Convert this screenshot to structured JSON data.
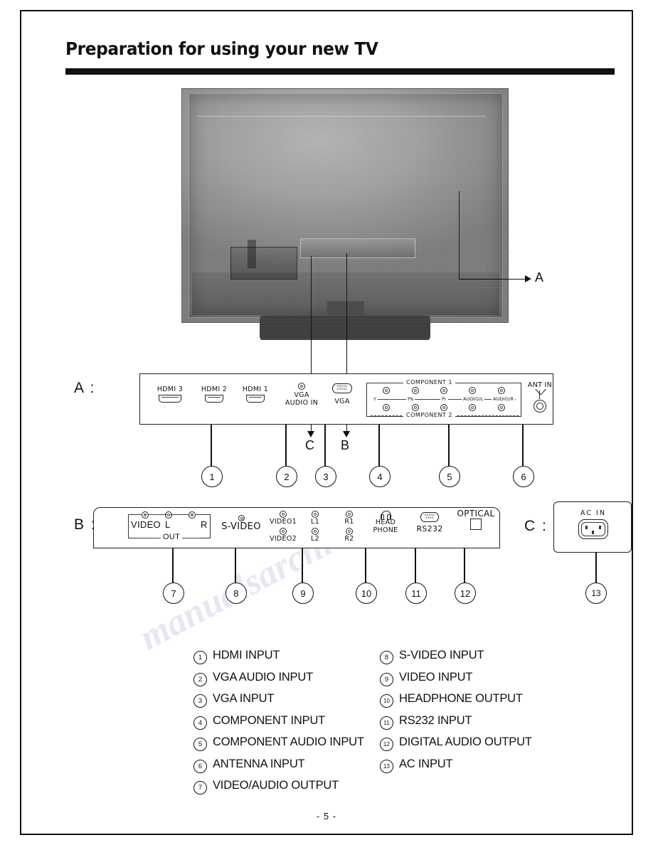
{
  "page": {
    "title": "Preparation for using your new TV",
    "footer": "- 5 -"
  },
  "photo": {
    "callout_a": "A",
    "callout_b": "B",
    "callout_c": "C"
  },
  "sections": {
    "a_label": "A :",
    "b_label": "B :",
    "c_label": "C :"
  },
  "panel_a": {
    "ports": [
      {
        "label": "HDMI 3",
        "icon": "hdmi-port-icon"
      },
      {
        "label": "HDMI 2",
        "icon": "hdmi-port-icon"
      },
      {
        "label": "HDMI 1",
        "icon": "hdmi-port-icon"
      },
      {
        "label_line1": "VGA",
        "label_line2": "AUDIO IN",
        "icon": "audio-jack-icon"
      },
      {
        "label": "VGA",
        "icon": "dsub-connector-icon"
      }
    ],
    "component": {
      "title_top": "COMPONENT 1",
      "title_bottom": "COMPONENT 2",
      "signals": [
        "Y",
        "Pb",
        "Pr",
        "AUDIO/L",
        "AUDIO/R"
      ]
    },
    "antenna": {
      "label": "ANT IN",
      "icon": "antenna-icon"
    }
  },
  "panel_b": {
    "video_out": {
      "video": "VIDEO",
      "left": "L",
      "right": "R",
      "out": "OUT"
    },
    "svideo": "S-VIDEO",
    "video_inputs": [
      "VIDEO1",
      "VIDEO2"
    ],
    "audio_left": [
      "L1",
      "L2"
    ],
    "audio_right": [
      "R1",
      "R2"
    ],
    "headphone_line1": "HEAD",
    "headphone_line2": "PHONE",
    "rs232": "RS232",
    "optical": "OPTICAL"
  },
  "panel_c": {
    "ac_in": "AC IN"
  },
  "callouts_a": [
    "1",
    "2",
    "3",
    "4",
    "5",
    "6"
  ],
  "callouts_b": [
    "7",
    "8",
    "9",
    "10",
    "11",
    "12"
  ],
  "callouts_c": [
    "13"
  ],
  "legend": {
    "left": [
      {
        "num": "1",
        "text": "HDMI INPUT"
      },
      {
        "num": "2",
        "text": "VGA  AUDIO INPUT"
      },
      {
        "num": "3",
        "text": "VGA INPUT"
      },
      {
        "num": "4",
        "text": "COMPONENT INPUT"
      },
      {
        "num": "5",
        "text": "COMPONENT AUDIO INPUT"
      },
      {
        "num": "6",
        "text": "ANTENNA INPUT"
      },
      {
        "num": "7",
        "text": "VIDEO/AUDIO OUTPUT"
      }
    ],
    "right": [
      {
        "num": "8",
        "text": "S-VIDEO INPUT"
      },
      {
        "num": "9",
        "text": "VIDEO INPUT"
      },
      {
        "num": "10",
        "text": "HEADPHONE OUTPUT"
      },
      {
        "num": "11",
        "text": "RS232 INPUT"
      },
      {
        "num": "12",
        "text": "DIGITAL AUDIO OUTPUT"
      },
      {
        "num": "13",
        "text": "AC INPUT"
      }
    ]
  },
  "watermark": {
    "text1": "manualsarchive",
    "text2": ".com"
  }
}
